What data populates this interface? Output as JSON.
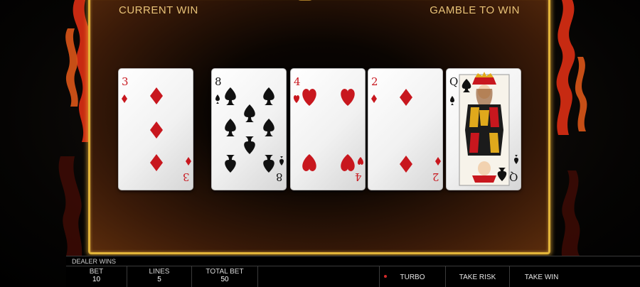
{
  "panel": {
    "current_win_label": "CURRENT WIN",
    "gamble_to_win_label": "GAMBLE TO WIN"
  },
  "cards": [
    {
      "rank": "3",
      "suit": "diamonds",
      "color": "#c8171e"
    },
    {
      "rank": "8",
      "suit": "spades",
      "color": "#111111"
    },
    {
      "rank": "4",
      "suit": "hearts",
      "color": "#c8171e"
    },
    {
      "rank": "2",
      "suit": "diamonds",
      "color": "#c8171e"
    },
    {
      "rank": "Q",
      "suit": "spades",
      "color": "#111111"
    }
  ],
  "status": {
    "message": "DEALER WINS"
  },
  "bet": {
    "label": "BET",
    "value": "10"
  },
  "lines": {
    "label": "LINES",
    "value": "5"
  },
  "total_bet": {
    "label": "TOTAL BET",
    "value": "50"
  },
  "buttons": {
    "turbo": "TURBO",
    "take_risk": "TAKE RISK",
    "take_win": "TAKE WIN"
  },
  "colors": {
    "frame_gold": "#e2b43a",
    "label_gold": "#e8c277",
    "flame": "#d8361a"
  }
}
